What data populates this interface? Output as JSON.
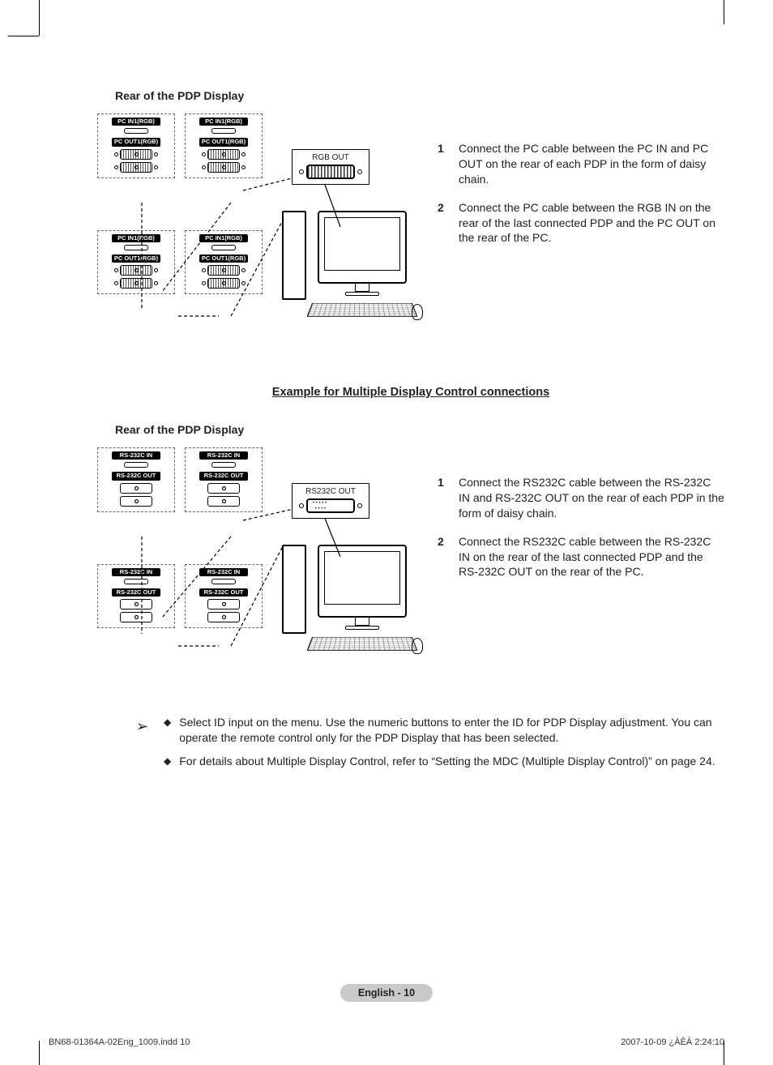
{
  "section1": {
    "title": "Rear of the PDP Display",
    "panel_labels": {
      "in": "PC IN1(RGB)",
      "out": "PC OUT1(RGB)"
    },
    "out_box_label": "RGB OUT",
    "steps": [
      {
        "num": "1",
        "text": "Connect the PC cable between the PC IN and PC OUT on the rear of each PDP in the form of daisy chain."
      },
      {
        "num": "2",
        "text": "Connect the PC cable between the RGB IN on the rear of the last connected PDP and the PC OUT on the rear of the PC."
      }
    ]
  },
  "mid_heading": "Example for Multiple Display Control connections",
  "section2": {
    "title": "Rear of the PDP Display",
    "panel_labels": {
      "in": "RS-232C IN",
      "out": "RS-232C OUT"
    },
    "out_box_label": "RS232C OUT",
    "steps": [
      {
        "num": "1",
        "text": "Connect the RS232C cable between the RS-232C IN and RS-232C OUT on the rear of each PDP in the form of daisy chain."
      },
      {
        "num": "2",
        "text": "Connect the RS232C cable between the RS-232C IN on the rear of the last connected PDP and the RS-232C OUT on the rear of the PC."
      }
    ]
  },
  "notes": [
    "Select ID input on the menu. Use the numeric buttons to enter the ID for PDP Display adjustment. You can operate the remote control only for the PDP Display that has been selected.",
    "For details about Multiple Display Control, refer to “Setting the MDC (Multiple Display Control)” on page 24."
  ],
  "page_badge": "English - 10",
  "footer": {
    "left": "BN68-01364A-02Eng_1009.indd   10",
    "right": "2007-10-09   ¿ÀÈÄ 2:24:10"
  }
}
